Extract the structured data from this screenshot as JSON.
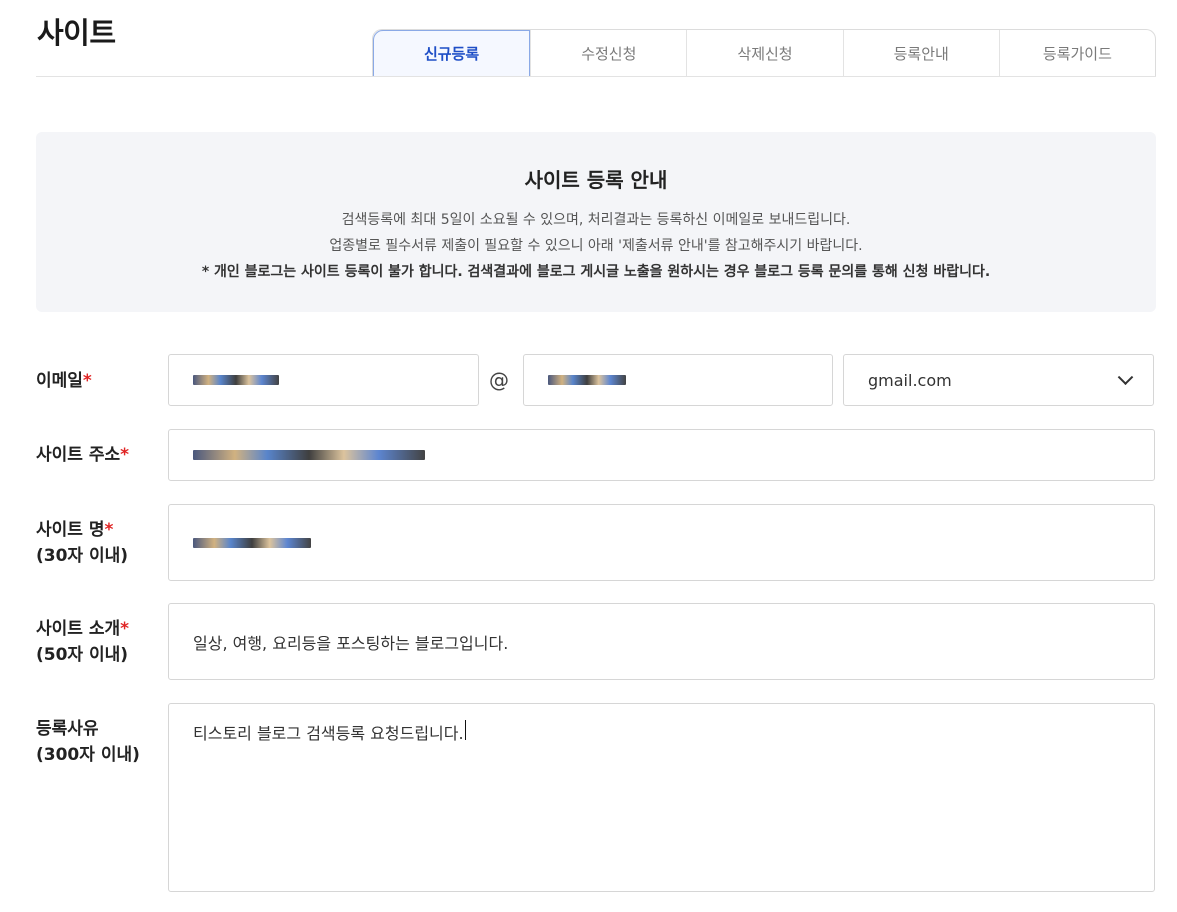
{
  "header": {
    "title": "사이트",
    "tabs": [
      {
        "label": "신규등록",
        "active": true
      },
      {
        "label": "수정신청",
        "active": false
      },
      {
        "label": "삭제신청",
        "active": false
      },
      {
        "label": "등록안내",
        "active": false
      },
      {
        "label": "등록가이드",
        "active": false
      }
    ]
  },
  "notice": {
    "title": "사이트 등록 안내",
    "line1": "검색등록에 최대 5일이 소요될 수 있으며, 처리결과는 등록하신 이메일로 보내드립니다.",
    "line2": "업종별로 필수서류 제출이 필요할 수 있으니 아래 '제출서류 안내'를 참고해주시기 바랍니다.",
    "line3": "* 개인 블로그는 사이트 등록이 불가 합니다. 검색결과에 블로그 게시글 노출을 원하시는 경우 블로그 등록 문의를 통해 신청 바랍니다."
  },
  "form": {
    "email": {
      "label": "이메일",
      "required_mark": "*",
      "at_symbol": "@",
      "domain_select": "gmail.com"
    },
    "site_url": {
      "label": "사이트 주소",
      "required_mark": "*"
    },
    "site_name": {
      "label": "사이트 명",
      "required_mark": "*",
      "limit": "(30자 이내)"
    },
    "site_intro": {
      "label": "사이트 소개",
      "required_mark": "*",
      "limit": "(50자 이내)",
      "value": "일상, 여행, 요리등을 포스팅하는 블로그입니다."
    },
    "reason": {
      "label": "등록사유",
      "limit": "(300자 이내)",
      "value": "티스토리 블로그 검색등록 요청드립니다."
    }
  },
  "colors": {
    "accent": "#1f4fc7",
    "required": "#e02424",
    "notice_bg": "#f4f5f8"
  }
}
